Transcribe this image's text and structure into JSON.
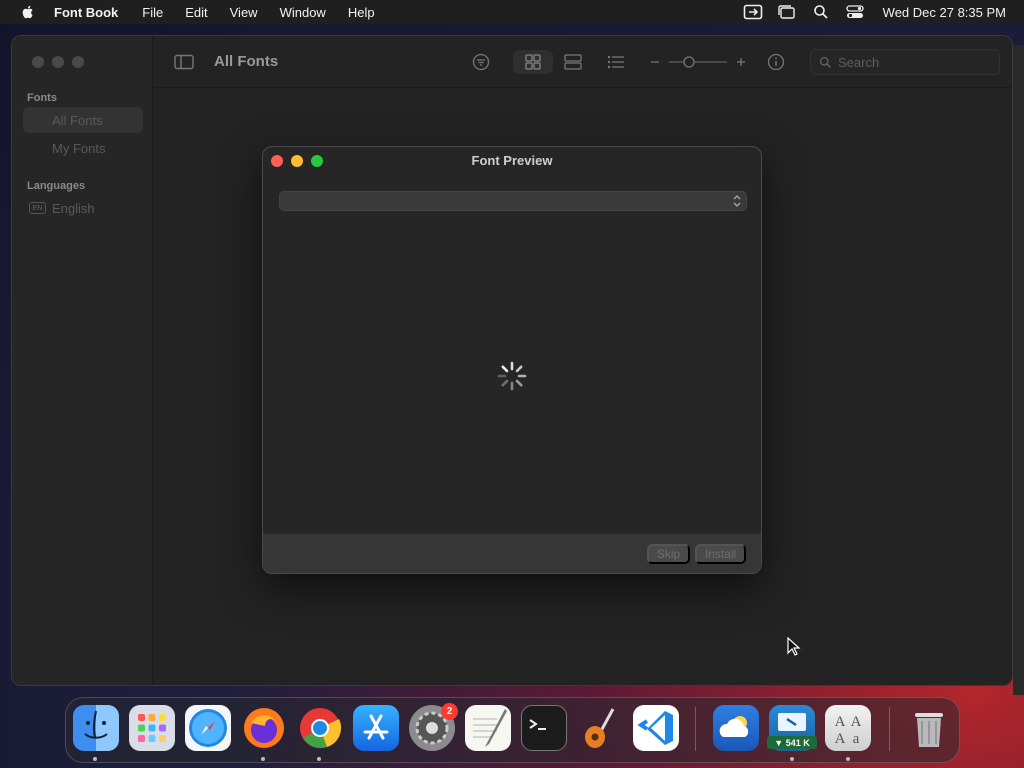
{
  "menubar": {
    "app_name": "Font Book",
    "items": [
      "File",
      "Edit",
      "View",
      "Window",
      "Help"
    ],
    "clock": "Wed Dec 27  8:35 PM"
  },
  "sidebar": {
    "fonts_header": "Fonts",
    "fonts_items": [
      "All Fonts",
      "My Fonts"
    ],
    "languages_header": "Languages",
    "language_badge": "EN",
    "language_item": "English"
  },
  "toolbar": {
    "title": "All Fonts",
    "search_placeholder": "Search"
  },
  "dialog": {
    "title": "Font Preview",
    "skip_label": "Skip",
    "install_label": "Install"
  },
  "dock": {
    "settings_badge": "2",
    "network_speed": "▼ 541 K"
  },
  "colors": {
    "close": "#ff5f57",
    "minimize": "#febc2e",
    "zoom": "#28c840",
    "badge": "#ff3b30"
  }
}
